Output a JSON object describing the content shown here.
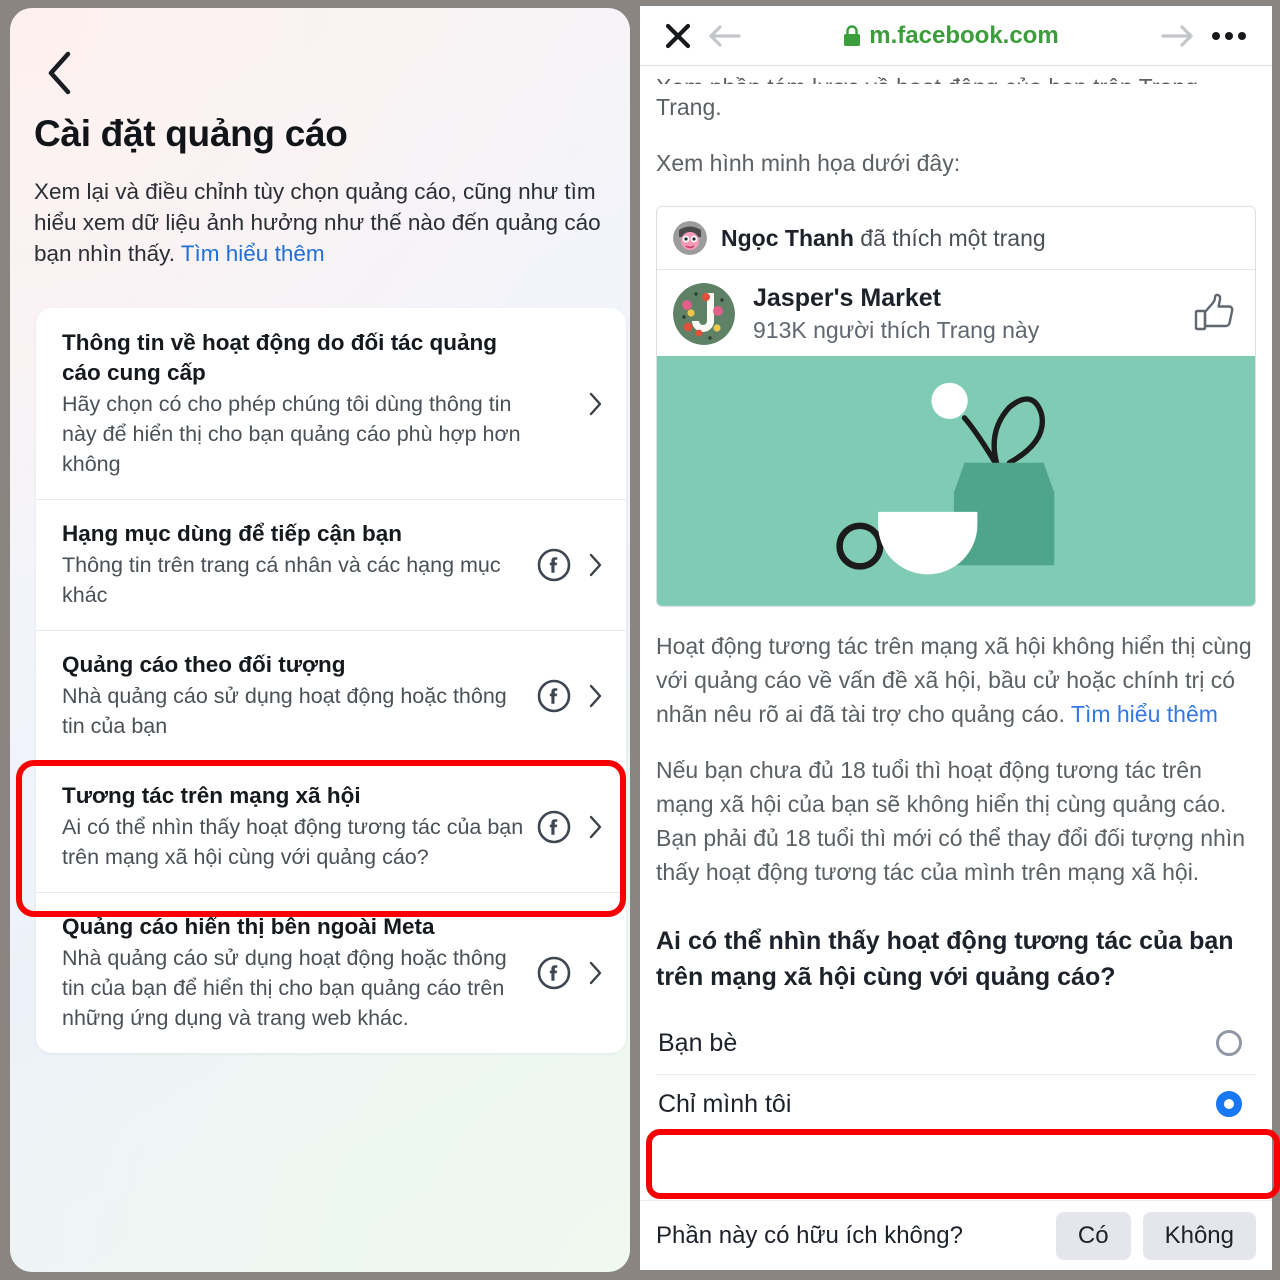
{
  "left": {
    "back_icon": "chevron-left-icon",
    "title": "Cài đặt quảng cáo",
    "description": "Xem lại và điều chỉnh tùy chọn quảng cáo, cũng như tìm hiểu xem dữ liệu ảnh hưởng như thế nào đến quảng cáo bạn nhìn thấy. ",
    "description_link": "Tìm hiểu thêm",
    "items": [
      {
        "title": "Thông tin về hoạt động do đối tác quảng cáo cung cấp",
        "subtitle": "Hãy chọn có cho phép chúng tôi dùng thông tin này để hiển thị cho bạn quảng cáo phù hợp hơn không",
        "has_fb_icon": false,
        "highlighted": false
      },
      {
        "title": "Hạng mục dùng để tiếp cận bạn",
        "subtitle": "Thông tin trên trang cá nhân và các hạng mục khác",
        "has_fb_icon": true,
        "highlighted": false
      },
      {
        "title": "Quảng cáo theo đối tượng",
        "subtitle": "Nhà quảng cáo sử dụng hoạt động hoặc thông tin của bạn",
        "has_fb_icon": true,
        "highlighted": false
      },
      {
        "title": "Tương tác trên mạng xã hội",
        "subtitle": "Ai có thể nhìn thấy hoạt động tương tác của bạn trên mạng xã hội cùng với quảng cáo?",
        "has_fb_icon": true,
        "highlighted": true
      },
      {
        "title": "Quảng cáo hiển thị bên ngoài Meta",
        "subtitle": "Nhà quảng cáo sử dụng hoạt động hoặc thông tin của bạn để hiển thị cho bạn quảng cáo trên những ứng dụng và trang web khác.",
        "has_fb_icon": true,
        "highlighted": false
      }
    ]
  },
  "right": {
    "browser": {
      "close_icon": "close-icon",
      "back_icon": "arrow-left-icon",
      "forward_icon": "arrow-right-icon",
      "lock_icon": "lock-icon",
      "url": "m.facebook.com",
      "menu_icon": "more-horizontal-icon",
      "url_color": "#3b9e3b"
    },
    "clipped_text": "Xem phần tóm lược về hoạt động của bạn trên Trang.",
    "para_trang": "Trang.",
    "para_xem": "Xem hình minh họa dưới đây:",
    "card": {
      "actor_name": "Ngọc Thanh",
      "actor_action": " đã thích một trang",
      "page_name": "Jasper's Market",
      "page_likes": "913K người thích Trang này",
      "like_icon": "thumbs-up-icon",
      "hero_bg_color": "#7fcbb4",
      "hero_vase_color": "#4fa58a",
      "avatar_actor_name": "actor-avatar",
      "avatar_page_name": "page-avatar"
    },
    "para1_a": "Hoạt động tương tác trên mạng xã hội không hiển thị cùng với quảng cáo về vấn đề xã hội, bầu cử hoặc chính trị có nhãn nêu rõ ai đã tài trợ cho quảng cáo. ",
    "para1_link": "Tìm hiểu thêm",
    "para2": "Nếu bạn chưa đủ 18 tuổi thì hoạt động tương tác trên mạng xã hội của bạn sẽ không hiển thị cùng quảng cáo. Bạn phải đủ 18 tuổi thì mới có thể thay đổi đối tượng nhìn thấy hoạt động tương tác của mình trên mạng xã hội.",
    "question": "Ai có thể nhìn thấy hoạt động tương tác của bạn trên mạng xã hội cùng với quảng cáo?",
    "options": [
      {
        "label": "Bạn bè",
        "selected": false,
        "highlighted": false
      },
      {
        "label": "Chỉ mình tôi",
        "selected": true,
        "highlighted": true
      }
    ],
    "footer": {
      "question": "Phần này có hữu ích không?",
      "yes": "Có",
      "no": "Không"
    }
  },
  "colors": {
    "highlight_red": "#f90000",
    "link_blue": "#3578e5",
    "radio_blue": "#1877f2"
  }
}
